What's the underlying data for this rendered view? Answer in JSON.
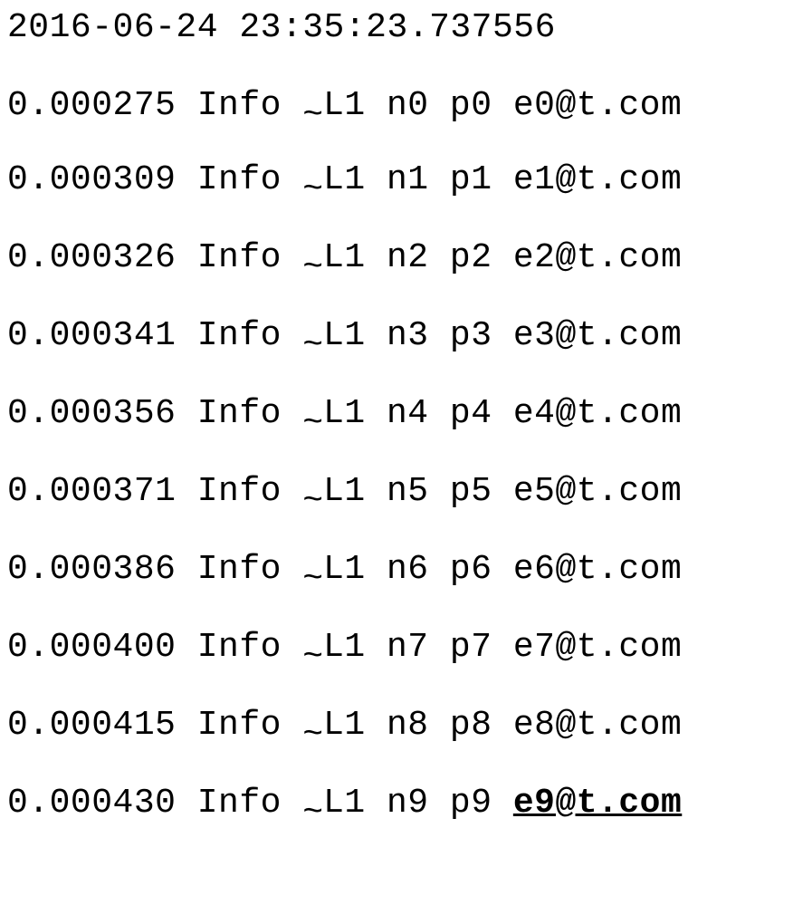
{
  "timestamp": "2016-06-24 23:35:23.737556",
  "lines": [
    {
      "time": "0.000275",
      "level": "Info",
      "tag": "L1",
      "n": "n0",
      "p": "p0",
      "email": "e0@t.com",
      "link": false
    },
    {
      "time": "0.000309",
      "level": "Info",
      "tag": "L1",
      "n": "n1",
      "p": "p1",
      "email": "e1@t.com",
      "link": false
    },
    {
      "time": "0.000326",
      "level": "Info",
      "tag": "L1",
      "n": "n2",
      "p": "p2",
      "email": "e2@t.com",
      "link": false
    },
    {
      "time": "0.000341",
      "level": "Info",
      "tag": "L1",
      "n": "n3",
      "p": "p3",
      "email": "e3@t.com",
      "link": false
    },
    {
      "time": "0.000356",
      "level": "Info",
      "tag": "L1",
      "n": "n4",
      "p": "p4",
      "email": "e4@t.com",
      "link": false
    },
    {
      "time": "0.000371",
      "level": "Info",
      "tag": "L1",
      "n": "n5",
      "p": "p5",
      "email": "e5@t.com",
      "link": false
    },
    {
      "time": "0.000386",
      "level": "Info",
      "tag": "L1",
      "n": "n6",
      "p": "p6",
      "email": "e6@t.com",
      "link": false
    },
    {
      "time": "0.000400",
      "level": "Info",
      "tag": "L1",
      "n": "n7",
      "p": "p7",
      "email": "e7@t.com",
      "link": false
    },
    {
      "time": "0.000415",
      "level": "Info",
      "tag": "L1",
      "n": "n8",
      "p": "p8",
      "email": "e8@t.com",
      "link": false
    },
    {
      "time": "0.000430",
      "level": "Info",
      "tag": "L1",
      "n": "n9",
      "p": "p9",
      "email": "e9@t.com",
      "link": true
    }
  ]
}
